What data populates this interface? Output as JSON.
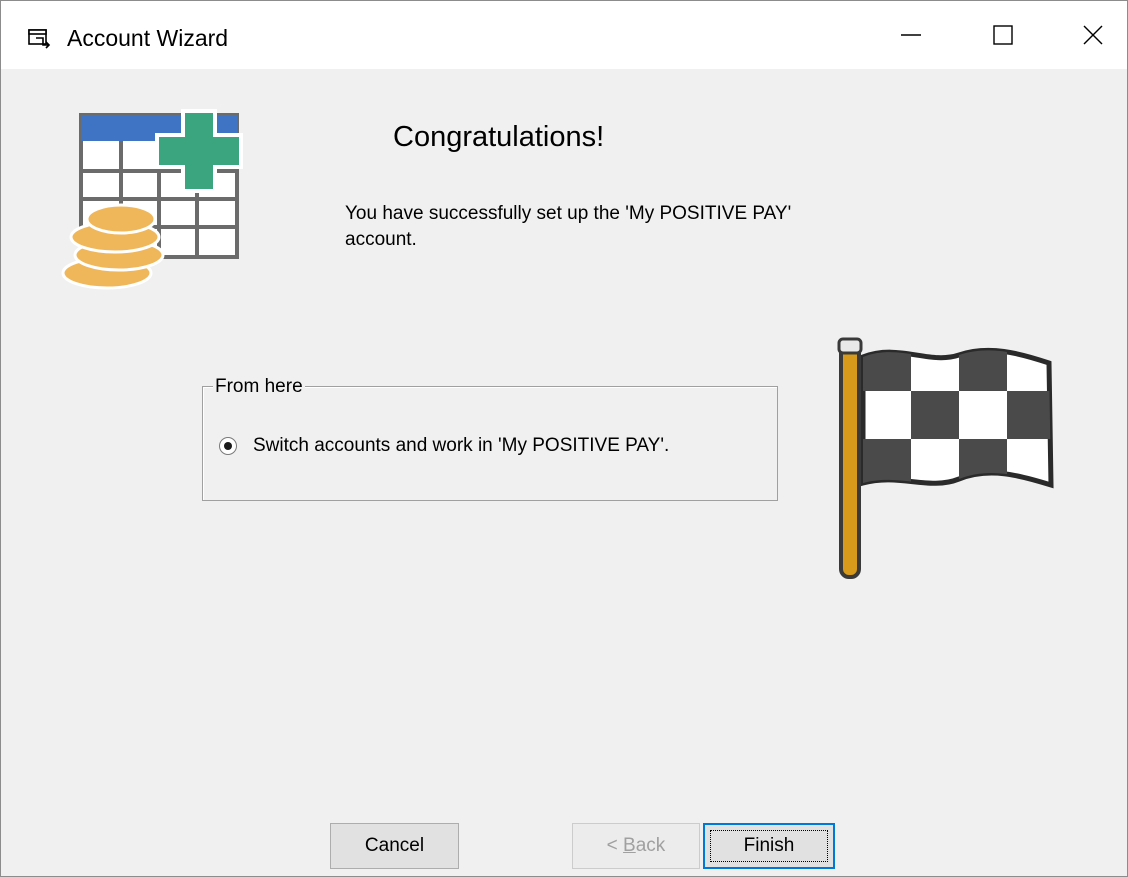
{
  "window": {
    "title": "Account Wizard",
    "icons": {
      "app": "wizard-app-icon",
      "minimize": "minimize-icon",
      "maximize": "maximize-icon",
      "close": "close-icon"
    }
  },
  "header": {
    "title": "Congratulations!",
    "message": "You have successfully set up the 'My POSITIVE PAY' account.",
    "art_icon": "ledger-coins-plus-icon"
  },
  "options": {
    "group_label": "From here",
    "radio_label": "Switch accounts and work in 'My POSITIVE PAY'.",
    "radio_selected": true
  },
  "finish_art_icon": "checkered-flag-icon",
  "buttons": {
    "cancel": "Cancel",
    "back_prefix": "< ",
    "back_accel": "B",
    "back_rest": "ack",
    "back_enabled": false,
    "finish": "Finish"
  },
  "colors": {
    "accent_focus": "#0078d7",
    "ledger_header": "#3f74c4",
    "plus_green": "#3aa57e",
    "coin_gold": "#f0b75a",
    "flag_pole": "#d79a1a"
  }
}
